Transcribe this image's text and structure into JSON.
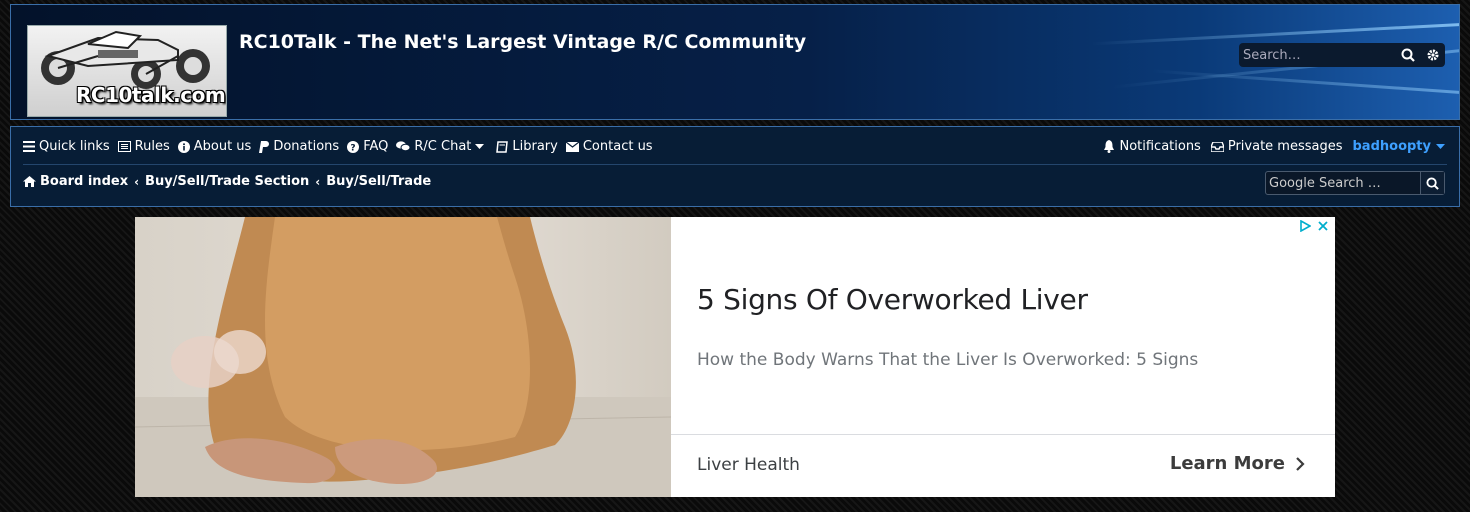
{
  "header": {
    "logo_text": "RC10talk.com",
    "site_title": "RC10Talk - The Net's Largest Vintage R/C Community",
    "search_placeholder": "Search…"
  },
  "nav": {
    "items": [
      {
        "label": "Quick links",
        "icon": "bars-icon"
      },
      {
        "label": "Rules",
        "icon": "list-icon"
      },
      {
        "label": "About us",
        "icon": "info-icon"
      },
      {
        "label": "Donations",
        "icon": "paypal-icon"
      },
      {
        "label": "FAQ",
        "icon": "question-icon"
      },
      {
        "label": "R/C Chat",
        "icon": "chat-icon"
      },
      {
        "label": "Library",
        "icon": "book-icon"
      },
      {
        "label": "Contact us",
        "icon": "envelope-icon"
      }
    ],
    "notifications": "Notifications",
    "private_messages": "Private messages",
    "username": "badhoopty"
  },
  "breadcrumbs": [
    "Board index",
    "Buy/Sell/Trade Section",
    "Buy/Sell/Trade"
  ],
  "google_search_placeholder": "Google Search …",
  "ad": {
    "headline": "5 Signs Of Overworked Liver",
    "description": "How the Body Warns That the Liver Is Overworked: 5 Signs",
    "brand": "Liver Health",
    "cta": "Learn More"
  },
  "colors": {
    "accent": "#3ea0ff",
    "header_bg": "#062048",
    "nav_bg": "#071d36",
    "border": "#3a6ea8"
  }
}
